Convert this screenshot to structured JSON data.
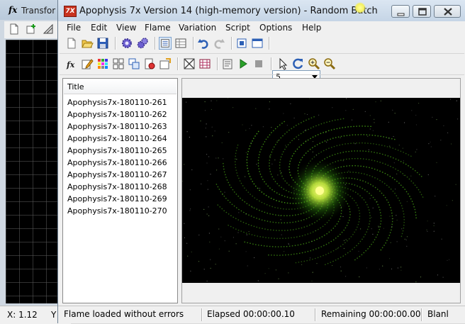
{
  "back_window": {
    "fx_glyph": "fx",
    "title": "Transfor",
    "status_x": "X: 1.12",
    "status_y": "Y"
  },
  "window": {
    "title": "Apophysis 7x Version 14 (high-memory version) - Random Batch",
    "app_icon_text": "7X"
  },
  "menu": [
    "File",
    "Edit",
    "View",
    "Flame",
    "Variation",
    "Script",
    "Options",
    "Help"
  ],
  "toolbar": {
    "combo_value": "5"
  },
  "list": {
    "header": "Title",
    "items": [
      "Apophysis7x-180110-261",
      "Apophysis7x-180110-262",
      "Apophysis7x-180110-263",
      "Apophysis7x-180110-264",
      "Apophysis7x-180110-265",
      "Apophysis7x-180110-266",
      "Apophysis7x-180110-267",
      "Apophysis7x-180110-268",
      "Apophysis7x-180110-269",
      "Apophysis7x-180110-270"
    ]
  },
  "status": {
    "message": "Flame loaded without errors",
    "elapsed": "Elapsed 00:00:00.10",
    "remaining": "Remaining 00:00:00.00",
    "extra": "Blanl"
  },
  "colors": {
    "flame_core": "#ffff60",
    "flame_arm": "#5bd21a",
    "canvas_bg": "#000000"
  }
}
